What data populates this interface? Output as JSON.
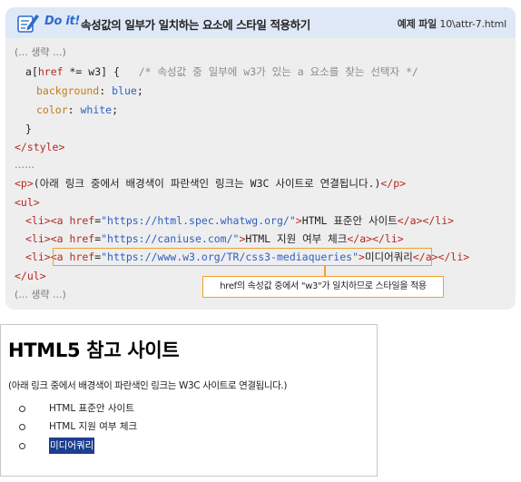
{
  "header": {
    "badge": "Do it!",
    "title": "속성값의 일부가 일치하는 요소에 스타일 적용하기",
    "file_label": "예제 파일",
    "file_path": "10\\attr-7.html"
  },
  "code": {
    "line1": "(... 생략 ...)",
    "line2_selector_tag": "a",
    "line2_bracket_open": "[",
    "line2_attr": "href",
    "line2_op": " *= ",
    "line2_val": "w3",
    "line2_bracket_close": "] {",
    "line2_comment": "/* 속성값 중 일부에 w3가 있는 a 요소를 찾는 선택자 */",
    "line3_prop": "background",
    "line3_colon": ": ",
    "line3_val": "blue",
    "line3_semi": ";",
    "line4_prop": "color",
    "line4_colon": ": ",
    "line4_val": "white",
    "line4_semi": ";",
    "line5": "}",
    "line6": "</style>",
    "line7": "……",
    "line8_open": "<p>",
    "line8_text": "(아래 링크 중에서 배경색이 파란색인 링크는 W3C 사이트로 연결됩니다.)",
    "line8_close": "</p>",
    "line9": "<ul>",
    "links": [
      {
        "li_open": "<li>",
        "a_open": "<a ",
        "attr": "href",
        "eq": "=",
        "url": "\"https://html.spec.whatwg.org/\"",
        "gt": ">",
        "text": "HTML 표준안 사이트",
        "a_close": "</a>",
        "li_close": "</li>"
      },
      {
        "li_open": "<li>",
        "a_open": "<a ",
        "attr": "href",
        "eq": "=",
        "url": "\"https://caniuse.com/\"",
        "gt": ">",
        "text": "HTML 지원 여부 체크",
        "a_close": "</a>",
        "li_close": "</li>"
      },
      {
        "li_open": "<li>",
        "a_open": "<a ",
        "attr": "href",
        "eq": "=",
        "url": "\"https://www.w3.org/TR/css3-mediaqueries\"",
        "gt": ">",
        "text": "미디어쿼리",
        "a_close": "</a>",
        "li_close": "</li>"
      }
    ],
    "line13": "</ul>",
    "line14": "(... 생략 ...)",
    "callout": "href의 속성값 중에서 \"w3\"가 일치하므로 스타일을 적용"
  },
  "output": {
    "heading": "HTML5 참고 사이트",
    "paragraph": "(아래 링크 중에서 배경색이 파란색인 링크는 W3C 사이트로 연결됩니다.)",
    "links": [
      "HTML 표준안 사이트",
      "HTML 지원 여부 체크",
      "미디어쿼리"
    ],
    "highlight_bg": "#1d3f8f",
    "highlight_fg": "#ffffff"
  },
  "colors": {
    "header_bg": "#dfe8f6",
    "code_bg": "#eeeeef",
    "accent_orange": "#f0a030",
    "tag_red": "#b52a1c",
    "string_blue": "#2f5fbf"
  }
}
